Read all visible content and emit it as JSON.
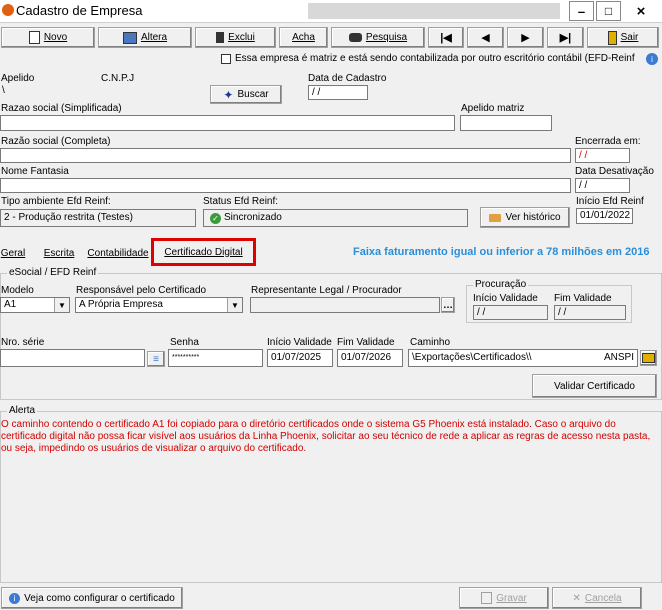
{
  "window": {
    "title": "Cadastro de Empresa",
    "controls": [
      "–",
      "□",
      "×"
    ]
  },
  "toolbar": {
    "novo": "Novo",
    "altera": "Altera",
    "exclui": "Exclui",
    "acha": "Acha",
    "pesquisa": "Pesquisa",
    "sair": "Sair"
  },
  "matriz_check_label": "Essa empresa é matriz e está sendo contabilizada por outro escritório contábil (EFD-Reinf",
  "labels": {
    "apelido": "Apelido",
    "cnpj": "C.N.P.J",
    "data_cadastro": "Data de Cadastro",
    "razao_simplificada": "Razao social (Simplificada)",
    "apelido_matriz": "Apelido matriz",
    "razao_completa": "Razão social (Completa)",
    "encerrada": "Encerrada em:",
    "nome_fantasia": "Nome Fantasia",
    "data_desativacao": "Data Desativação",
    "tipo_ambiente": "Tipo ambiente Efd Reinf:",
    "status_efd": "Status Efd Reinf:",
    "inicio_efd": "Início Efd Reinf"
  },
  "values": {
    "apelido": "\\",
    "data_cadastro": "/ /",
    "encerrada": "/ /",
    "data_desativacao": "/ /",
    "tipo_ambiente": "2 - Produção restrita (Testes)",
    "status_efd": "Sincronizado",
    "inicio_efd": "01/01/2022"
  },
  "buttons": {
    "buscar": "Buscar",
    "ver_historico": "Ver histórico",
    "validar": "Validar Certificado",
    "veja_como": "Veja como configurar o certificado",
    "gravar": "Gravar",
    "cancela": "Cancela"
  },
  "tabs": {
    "geral": "Geral",
    "escrita": "Escrita",
    "contabilidade": "Contabilidade",
    "certificado": "Certificado Digital"
  },
  "faixa": "Faixa faturamento igual ou inferior a 78 milhões em 2016",
  "esocial": {
    "group": "eSocial / EFD Reinf",
    "modelo_label": "Modelo",
    "modelo": "A1",
    "responsavel_label": "Responsável pelo Certificado",
    "responsavel": "A Própria Empresa",
    "representante_label": "Representante Legal / Procurador",
    "procuracao_group": "Procuração",
    "inicio_validade_label": "Início Validade",
    "fim_validade_label": "Fim Validade",
    "proc_inicio": "/ /",
    "proc_fim": "/ /",
    "nro_serie_label": "Nro. série",
    "senha_label": "Senha",
    "senha": "**********",
    "inicio_val_label": "Início Validade",
    "fim_val_label": "Fim Validade",
    "inicio_val": "01/07/2025",
    "fim_val": "01/07/2026",
    "caminho_label": "Caminho",
    "caminho": "\\Exportações\\Certificados\\\\",
    "caminho_suffix": "ANSPI"
  },
  "alerta": {
    "group": "Alerta",
    "text": "O caminho contendo o certificado A1 foi copiado para o diretório certificados onde o sistema G5 Phoenix está instalado. Caso o arquivo do certificado digital não possa ficar visível aos usuários da Linha Phoenix, solicitar ao seu técnico de rede a aplicar as regras de acesso nesta pasta, ou seja, impedindo os usuários de visualizar o arquivo do certificado."
  }
}
